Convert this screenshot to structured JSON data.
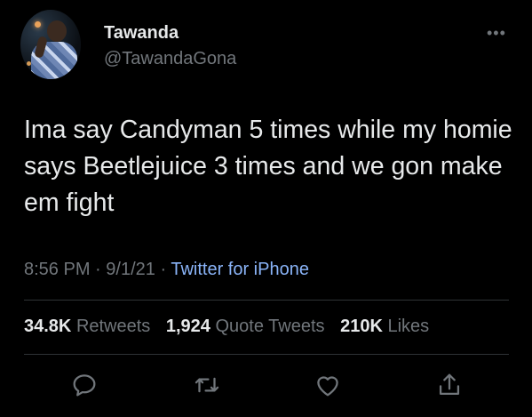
{
  "author": {
    "name": "Tawanda",
    "handle": "@TawandaGona"
  },
  "tweet": {
    "text": "Ima say Candyman 5 times while my homie says Beetlejuice 3 times and we gon make em fight",
    "time": "8:56 PM",
    "date": "9/1/21",
    "source": "Twitter for iPhone",
    "separator": "·"
  },
  "stats": {
    "retweets_count": "34.8K",
    "retweets_label": "Retweets",
    "quotes_count": "1,924",
    "quotes_label": "Quote Tweets",
    "likes_count": "210K",
    "likes_label": "Likes"
  },
  "more_glyph": "•••",
  "icons": {
    "reply": "reply-icon",
    "retweet": "retweet-icon",
    "like": "heart-icon",
    "share": "share-icon"
  },
  "colors": {
    "background": "#000000",
    "text": "#e7e9ea",
    "secondary": "#71767b",
    "link": "#8ab4f8",
    "divider": "#2f3336"
  }
}
